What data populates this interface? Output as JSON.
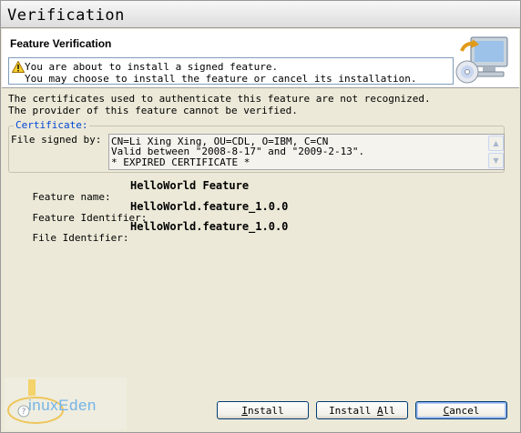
{
  "window": {
    "title": "Verification"
  },
  "header": {
    "title": "Feature Verification",
    "message_line1": "You are about to install a signed feature.",
    "message_line2": "You may choose to install the feature or cancel its installation."
  },
  "description": {
    "line1": "The certificates used to authenticate this feature are not recognized.",
    "line2": "The provider of this feature cannot be verified."
  },
  "certificate": {
    "legend": "Certificate:",
    "label": "File signed by:",
    "lines": [
      "CN=Li Xing Xing, OU=CDL, O=IBM, C=CN",
      "Valid between \"2008-8-17\" and \"2009-2-13\".",
      "* EXPIRED CERTIFICATE *"
    ]
  },
  "details": [
    {
      "label": "Feature name:",
      "value": "HelloWorld Feature"
    },
    {
      "label": "Feature Identifier:",
      "value": "HelloWorld.feature_1.0.0"
    },
    {
      "label": "File Identifier:",
      "value": "HelloWorld.feature_1.0.0"
    }
  ],
  "buttons": {
    "install": {
      "first": "I",
      "rest": "nstall"
    },
    "install_all": {
      "before": "Install ",
      "mnemonic": "A",
      "after": "ll"
    },
    "cancel": {
      "first": "C",
      "rest": "ancel"
    }
  },
  "watermark": {
    "text": "inuxEden"
  },
  "icons": {
    "warning": "warning-icon",
    "header": "computer-cd-icon",
    "help": "help-icon"
  }
}
